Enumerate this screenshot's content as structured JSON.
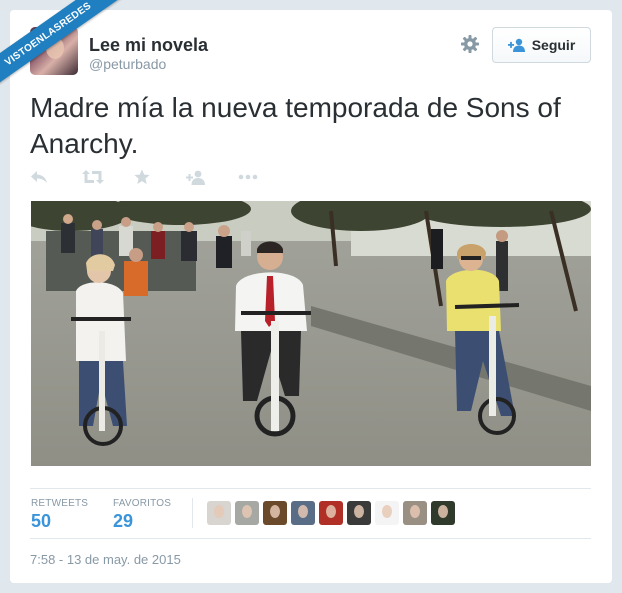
{
  "watermark": {
    "text": "VISTOENLASREDES"
  },
  "tweet": {
    "author": {
      "display_name": "Lee mi novela",
      "screen_name": "@peturbado"
    },
    "follow_button": {
      "label": "Seguir",
      "icon": "add-user-icon"
    },
    "settings_icon": "gear-icon",
    "text": "Madre mía la nueva temporada de Sons of Anarchy.",
    "actions": [
      "reply-icon",
      "retweet-icon",
      "favorite-icon",
      "follow-icon",
      "more-icon"
    ],
    "media": {
      "type": "photo",
      "subject": "people riding bicycles"
    },
    "stats": {
      "retweets_label": "RETWEETS",
      "retweets": "50",
      "favorites_label": "FAVORITOS",
      "favorites": "29"
    },
    "favoriters": [
      {
        "color": "#d8d4cf"
      },
      {
        "color": "#a6a8a4"
      },
      {
        "color": "#6a4a2a"
      },
      {
        "color": "#5a6d86"
      },
      {
        "color": "#b03028"
      },
      {
        "color": "#3a3a3a"
      },
      {
        "color": "#f4f4f4"
      },
      {
        "color": "#9a8f83"
      },
      {
        "color": "#2f3a2c"
      }
    ],
    "timestamp": "7:58 - 13 de may. de 2015"
  },
  "colors": {
    "link": "#3b94d9",
    "text": "#292f33",
    "muted": "#8899a6",
    "ribbon": "#1f7fc0"
  }
}
